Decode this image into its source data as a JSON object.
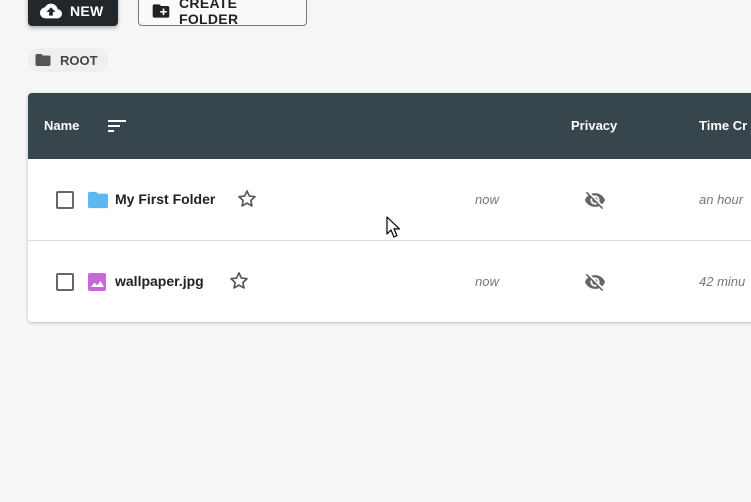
{
  "toolbar": {
    "new_label": "NEW",
    "create_folder_label": "CREATE FOLDER"
  },
  "breadcrumb": {
    "root_label": "ROOT"
  },
  "table": {
    "headers": {
      "name": "Name",
      "privacy": "Privacy",
      "time_created": "Time Cr"
    },
    "rows": [
      {
        "name": "My First Folder",
        "type": "folder",
        "modified": "now",
        "privacy": "hidden",
        "time_created": "an hour"
      },
      {
        "name": "wallpaper.jpg",
        "type": "image",
        "modified": "now",
        "privacy": "hidden",
        "time_created": "42 minu"
      }
    ]
  },
  "colors": {
    "header_bg": "#37464d",
    "new_button_bg": "#22272b",
    "folder_icon": "#5bb8f0",
    "image_icon": "#c868d8"
  }
}
